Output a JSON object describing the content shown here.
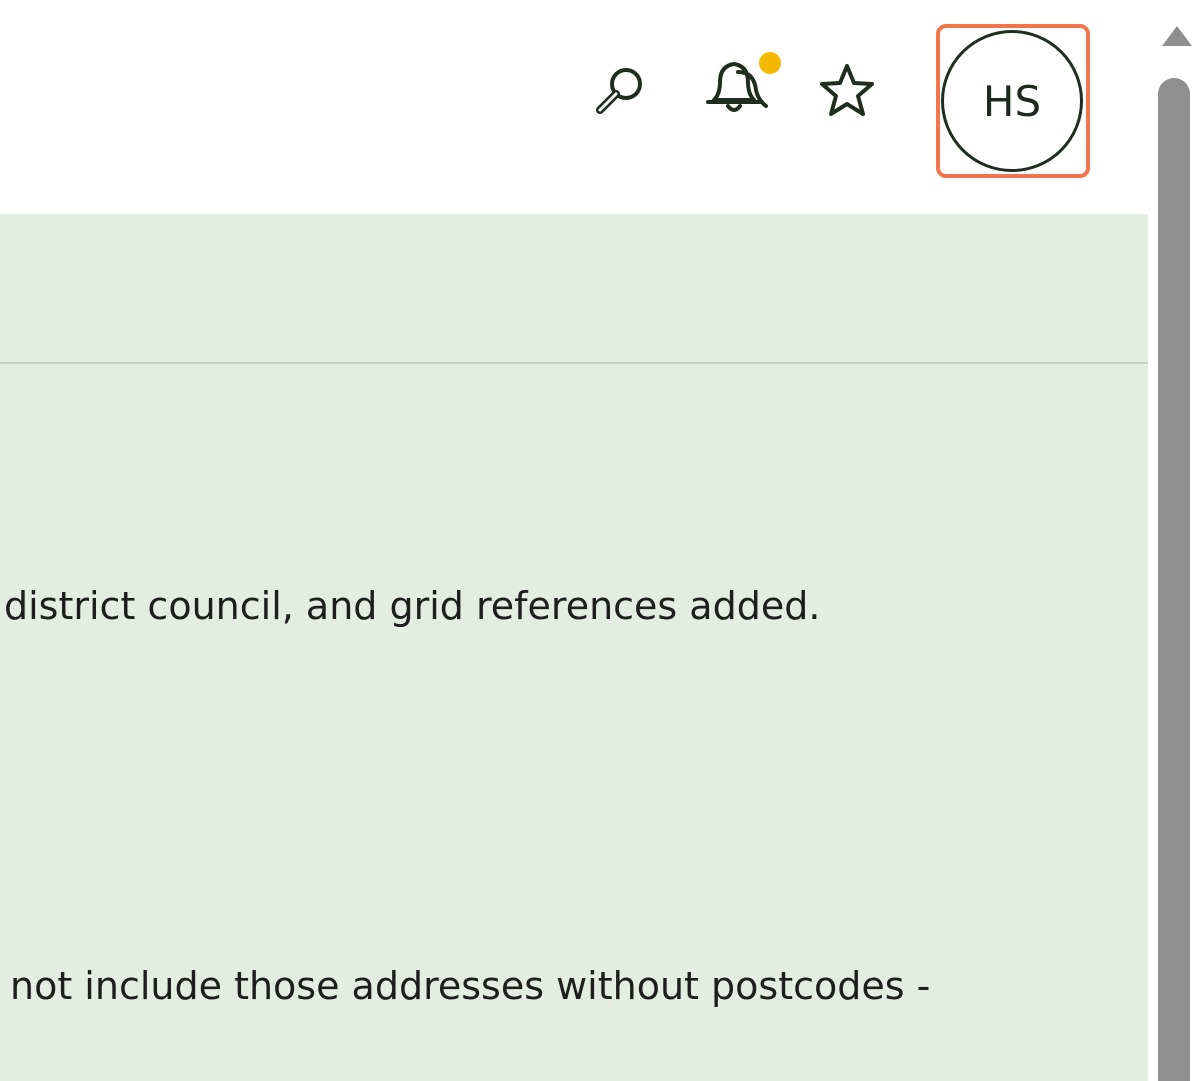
{
  "header": {
    "icons": {
      "search": "search-icon",
      "notifications": "bell-icon",
      "favorites": "star-icon"
    },
    "notification_dot_color": "#f5b800",
    "avatar": {
      "initials": "HS",
      "highlight_color": "#f2764a"
    }
  },
  "content": {
    "background_color": "#e4ede1",
    "lines": [
      "district council, and grid references added.",
      "not include those addresses without postcodes -"
    ]
  }
}
